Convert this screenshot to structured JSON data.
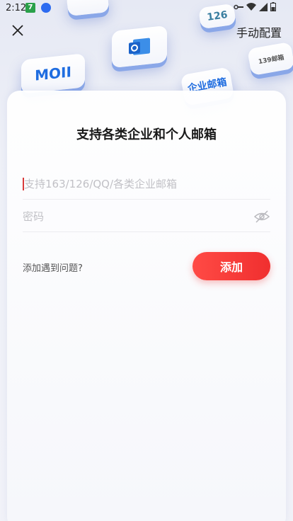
{
  "status_bar": {
    "time": "2:12",
    "badge_text": "7",
    "icons": [
      "key-icon",
      "wifi-icon",
      "signal-icon",
      "battery-icon"
    ]
  },
  "top_bar": {
    "close_icon": "close-icon",
    "manual_config_label": "手动配置"
  },
  "decor": {
    "mail_tile_text": "MOII",
    "tile_126_text": "126",
    "tile_139_text": "139邮箱",
    "tile_enterprise_text": "企业邮箱"
  },
  "form": {
    "title": "支持各类企业和个人邮箱",
    "email_placeholder": "支持163/126/QQ/各类企业邮箱",
    "email_value": "",
    "password_placeholder": "密码",
    "password_value": "",
    "problem_link": "添加遇到问题?",
    "add_button_label": "添加"
  },
  "colors": {
    "accent": "#f03a35",
    "tile_shadow": "#8aa7e8",
    "background": "#eef0f7"
  }
}
